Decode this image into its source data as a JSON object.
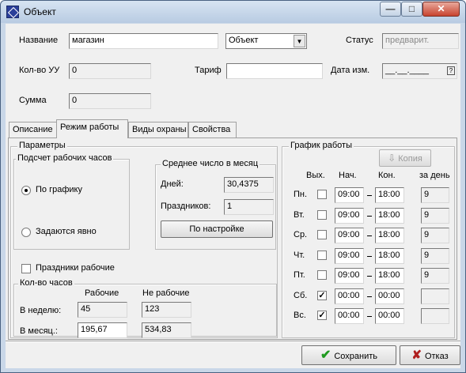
{
  "window": {
    "title": "Объект",
    "minimize": "—",
    "maximize": "□",
    "close": "✕"
  },
  "header": {
    "name_label": "Название",
    "name_value": "магазин",
    "type_value": "Объект",
    "status_label": "Статус",
    "status_value": "предварит.",
    "count_label": "Кол-во УУ",
    "count_value": "0",
    "tariff_label": "Тариф",
    "tariff_value": "",
    "date_label": "Дата изм.",
    "date_value": "__.__.____",
    "date_btn": "?",
    "sum_label": "Сумма",
    "sum_value": "0"
  },
  "tabs": [
    "Описание",
    "Режим работы",
    "Виды охраны",
    "Свойства"
  ],
  "params": {
    "title": "Параметры",
    "calc_title": "Подсчет рабочих часов",
    "radio1": "По графику",
    "radio2": "Задаются явно",
    "avg_title": "Среднее число в месяц",
    "days_label": "Дней:",
    "days_value": "30,4375",
    "holidays_label": "Праздников:",
    "holidays_value": "1",
    "settings_btn": "По настройке",
    "holidays_working": "Праздники  рабочие"
  },
  "hours": {
    "title": "Кол-во часов",
    "col_work": "Рабочие",
    "col_nonwork": "Не рабочие",
    "week_label": "В неделю:",
    "week_work": "45",
    "week_nonwork": "123",
    "month_label": "В месяц.:",
    "month_work": "195,67",
    "month_nonwork": "534,83"
  },
  "schedule": {
    "title": "График работы",
    "copy_btn": "Копия",
    "col_off": "Вых.",
    "col_start": "Нач.",
    "col_end": "Кон.",
    "col_day": "за день",
    "rows": [
      {
        "day": "Пн.",
        "off": false,
        "start": "09:00",
        "end": "18:00",
        "total": "9"
      },
      {
        "day": "Вт.",
        "off": false,
        "start": "09:00",
        "end": "18:00",
        "total": "9"
      },
      {
        "day": "Ср.",
        "off": false,
        "start": "09:00",
        "end": "18:00",
        "total": "9"
      },
      {
        "day": "Чт.",
        "off": false,
        "start": "09:00",
        "end": "18:00",
        "total": "9"
      },
      {
        "day": "Пт.",
        "off": false,
        "start": "09:00",
        "end": "18:00",
        "total": "9"
      },
      {
        "day": "Сб.",
        "off": true,
        "start": "00:00",
        "end": "00:00",
        "total": ""
      },
      {
        "day": "Вс.",
        "off": true,
        "start": "00:00",
        "end": "00:00",
        "total": ""
      }
    ]
  },
  "footer": {
    "save": "Сохранить",
    "cancel": "Отказ"
  },
  "colors": {
    "save_icon": "#1f9a1f",
    "cancel_icon": "#b02020"
  }
}
